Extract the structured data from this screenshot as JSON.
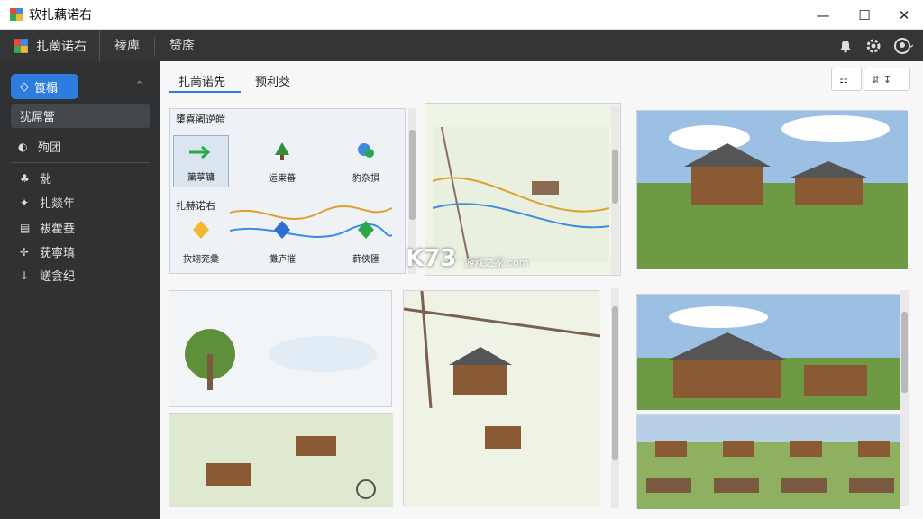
{
  "window": {
    "title": "软扎藕诺右",
    "controls": [
      "—",
      "☐",
      "✕"
    ]
  },
  "menubar": {
    "logo_label": "扎萳诺右",
    "tabs": [
      "祾庳",
      "赟庩"
    ],
    "icons": [
      "bell-icon",
      "gear-icon",
      "user-icon"
    ]
  },
  "sidebar": {
    "selected_label": "筤榻",
    "sub_label": "犹屌簹",
    "group_label": "殉团",
    "items": [
      "龀",
      "扎燚年",
      "袚藿蛬",
      "莸寧瑱",
      "嵯侌纪"
    ]
  },
  "tabs": [
    "扎萳诺先",
    "预利茭"
  ],
  "palette": {
    "title": "橥喜阇逆皚",
    "section": "扎赫诺右",
    "row1": [
      "簘莩镛",
      "运粜蕃",
      "豹杂損"
    ],
    "row2": [
      "扻翊兖彙",
      "攤庐摧",
      "蓒俠匯"
    ]
  },
  "watermark": {
    "main": "K73",
    "sub": "游戏之家",
    "domain": ".com"
  },
  "colors": {
    "accent": "#2d7de0",
    "dark": "#333537"
  }
}
